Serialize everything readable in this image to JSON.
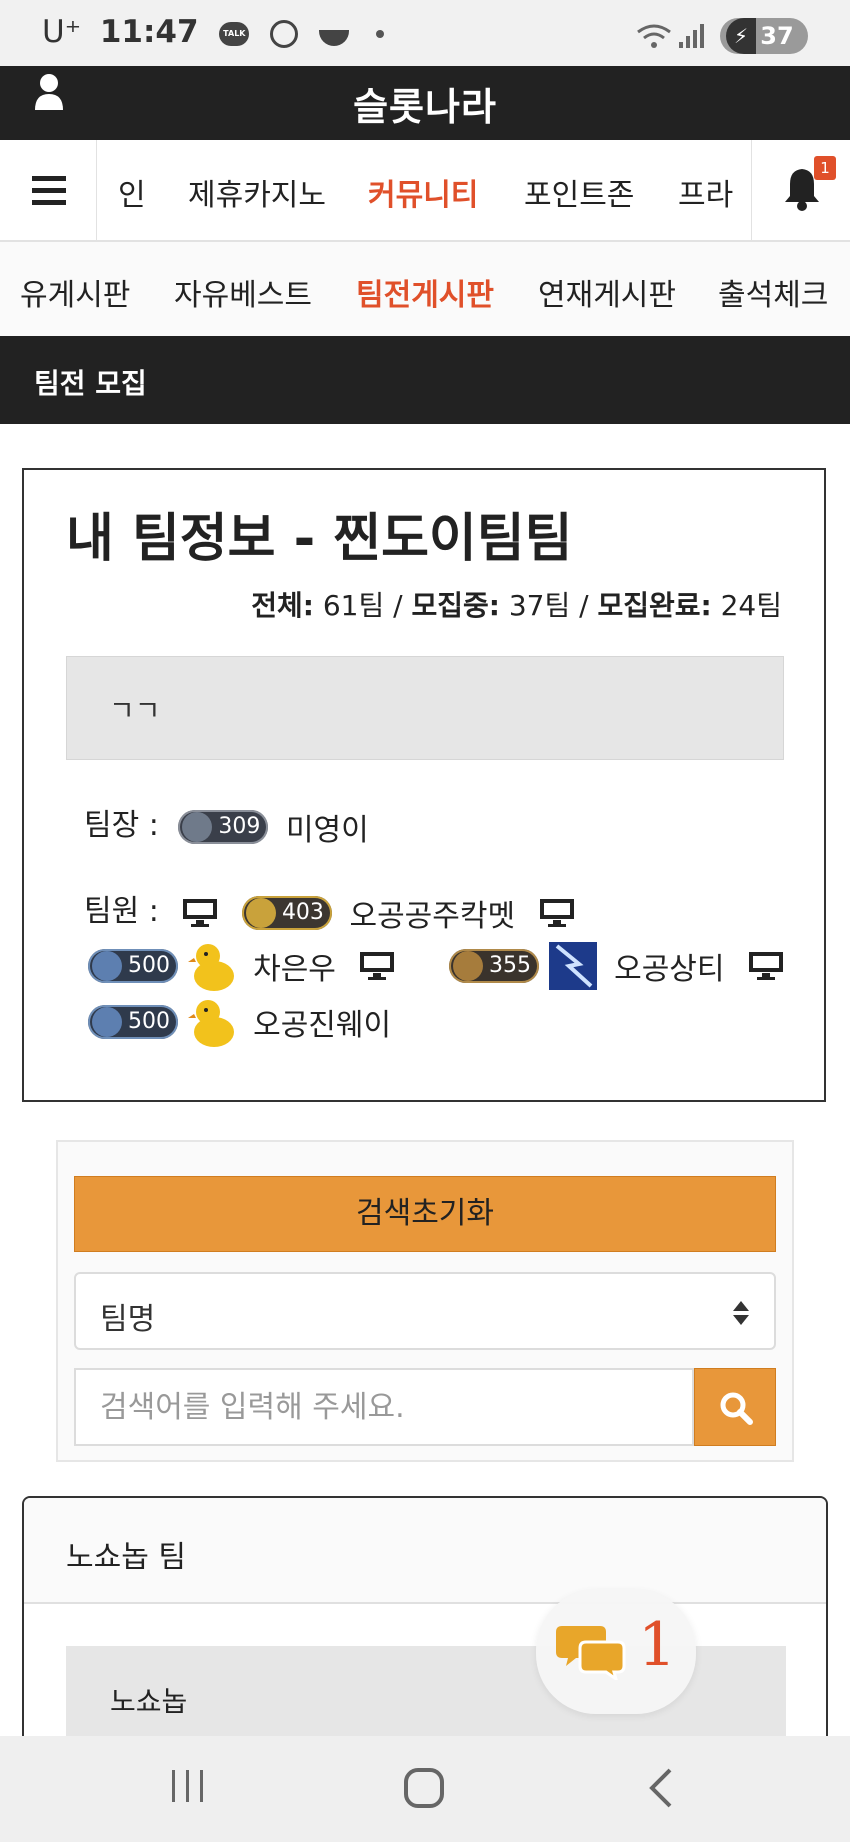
{
  "status_bar": {
    "carrier": "U⁺",
    "time": "11:47",
    "talk_label": "TALK",
    "battery": "37"
  },
  "header": {
    "site_title": "슬롯나라"
  },
  "main_nav": {
    "items": [
      {
        "label": "인",
        "active": false
      },
      {
        "label": "제휴카지노",
        "active": false
      },
      {
        "label": "커뮤니티",
        "active": true
      },
      {
        "label": "포인트존",
        "active": false
      },
      {
        "label": "프라",
        "active": false
      }
    ],
    "notification_count": "1"
  },
  "sub_nav": {
    "items": [
      {
        "label": "유게시판",
        "active": false
      },
      {
        "label": "자유베스트",
        "active": false
      },
      {
        "label": "팀전게시판",
        "active": true
      },
      {
        "label": "연재게시판",
        "active": false
      },
      {
        "label": "출석체크",
        "active": false
      }
    ]
  },
  "section": {
    "title": "팀전 모집"
  },
  "team_card": {
    "title": "내 팀정보 - 찐도이팀팀",
    "stats": {
      "total_label": "전체:",
      "total_value": "61팀",
      "recruiting_label": "모집중:",
      "recruiting_value": "37팀",
      "done_label": "모집완료:",
      "done_value": "24팀",
      "separator": " / "
    },
    "message": "ㄱㄱ",
    "leader_label": "팀장 :",
    "leader": {
      "level": "309",
      "name": "미영이"
    },
    "members_label": "팀원 :",
    "members": [
      {
        "level": "403",
        "name": "오공공주칵멧"
      },
      {
        "level": "500",
        "name": "차은우"
      },
      {
        "level": "355",
        "name": "오공상티"
      },
      {
        "level": "500",
        "name": "오공진웨이"
      }
    ]
  },
  "search": {
    "reset_label": "검색초기화",
    "select_value": "팀명",
    "placeholder": "검색어를 입력해 주세요."
  },
  "noshow": {
    "title": "노쇼놉 팀",
    "message": "노쇼놉"
  },
  "chat": {
    "count": "1"
  },
  "colors": {
    "accent": "#e0502a",
    "orange_button": "#e8973a",
    "dark": "#222222"
  }
}
